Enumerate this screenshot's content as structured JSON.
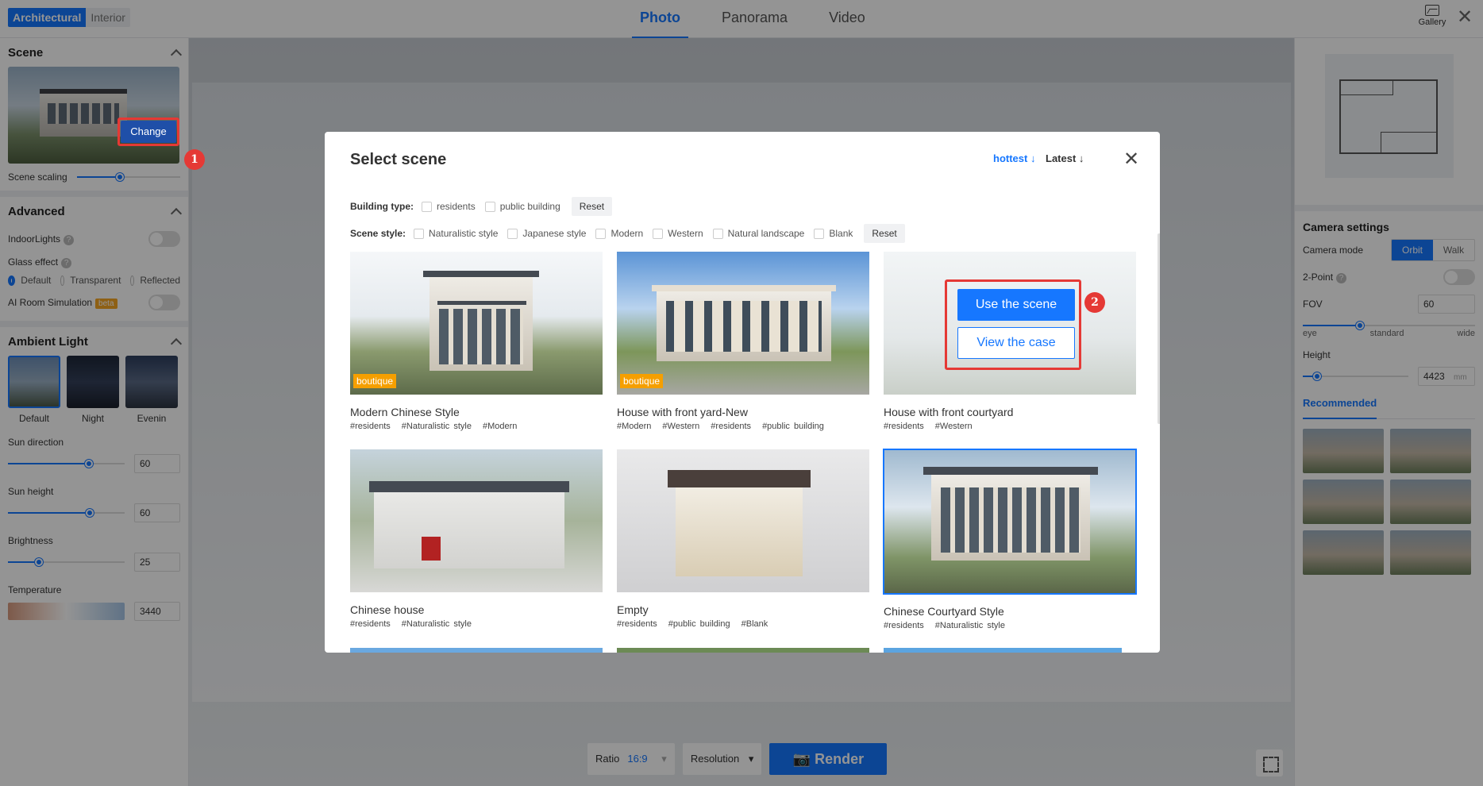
{
  "topbar": {
    "mode_active": "Architectural",
    "mode_inactive": "Interior",
    "tabs": [
      "Photo",
      "Panorama",
      "Video"
    ],
    "gallery_label": "Gallery",
    "close_glyph": "✕"
  },
  "left": {
    "scene_title": "Scene",
    "change_label": "Change",
    "scaling_label": "Scene scaling",
    "scaling_value": 0.27,
    "advanced_title": "Advanced",
    "indoor_lights": "IndoorLights",
    "glass_effect": "Glass effect",
    "glass_options": [
      "Default",
      "Transparent",
      "Reflected"
    ],
    "glass_selected": "Default",
    "ai_room": "AI Room Simulation",
    "beta": "beta",
    "ambient_title": "Ambient Light",
    "ambient": [
      "Default",
      "Night",
      "Evenin"
    ],
    "sun_direction": "Sun direction",
    "sun_direction_value": "60",
    "sun_height": "Sun height",
    "sun_height_value": "60",
    "brightness": "Brightness",
    "brightness_value": "25",
    "temperature": "Temperature",
    "temperature_value": "3440"
  },
  "bottom": {
    "ratio_label": "Ratio",
    "ratio_value": "16:9",
    "resolution_label": "Resolution",
    "render_label": "Render"
  },
  "right": {
    "camera_title": "Camera settings",
    "camera_mode": "Camera mode",
    "orbit": "Orbit",
    "walk": "Walk",
    "two_point": "2-Point",
    "fov_label": "FOV",
    "fov_value": "60",
    "fov_scale": [
      "eye",
      "standard",
      "wide"
    ],
    "height_label": "Height",
    "height_value": "4423",
    "height_unit": "mm",
    "recommended": "Recommended"
  },
  "modal": {
    "title": "Select scene",
    "sort_hottest": "hottest ↓",
    "sort_latest": "Latest ↓",
    "close_glyph": "✕",
    "building_type_label": "Building type:",
    "building_types": [
      "residents",
      "public building"
    ],
    "scene_style_label": "Scene style:",
    "scene_styles": [
      "Naturalistic style",
      "Japanese style",
      "Modern",
      "Western",
      "Natural landscape",
      "Blank"
    ],
    "reset": "Reset",
    "cards": [
      {
        "name": "Modern Chinese Style",
        "tags": [
          "#residents",
          "#Naturalistic style",
          "#Modern"
        ],
        "boutique": "boutique"
      },
      {
        "name": "House with front yard-New",
        "tags": [
          "#Modern",
          "#Western",
          "#residents",
          "#public building"
        ],
        "boutique": "boutique"
      },
      {
        "name": "House with front courtyard",
        "tags": [
          "#residents",
          "#Western"
        ]
      },
      {
        "name": "Chinese house",
        "tags": [
          "#residents",
          "#Naturalistic style"
        ]
      },
      {
        "name": "Empty",
        "tags": [
          "#residents",
          "#public building",
          "#Blank"
        ]
      },
      {
        "name": "Chinese Courtyard Style",
        "tags": [
          "#residents",
          "#Naturalistic style"
        ]
      }
    ],
    "use_scene": "Use the scene",
    "view_case": "View the case"
  },
  "annotations": {
    "step1": "1",
    "step2": "2"
  },
  "colors": {
    "accent": "#1677ff",
    "highlight": "#e53935",
    "boutique": "#f59f00"
  }
}
